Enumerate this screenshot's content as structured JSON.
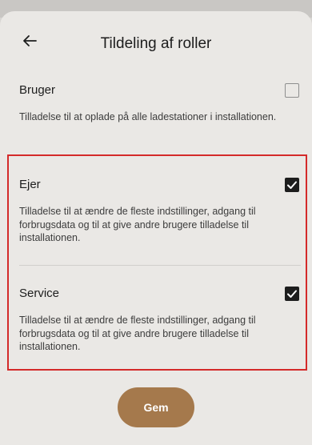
{
  "header": {
    "title": "Tildeling af roller"
  },
  "roles": [
    {
      "name": "Bruger",
      "checked": false,
      "description": "Tilladelse til at oplade på alle ladestationer i installationen."
    },
    {
      "name": "Ejer",
      "checked": true,
      "description": "Tilladelse til at ændre de fleste indstillinger, adgang til forbrugsdata og til at give andre brugere tilladelse til installationen."
    },
    {
      "name": "Service",
      "checked": true,
      "description": "Tilladelse til at ændre de fleste indstillinger, adgang til forbrugsdata og til at give andre brugere tilladelse til installationen."
    }
  ],
  "footer": {
    "save_label": "Gem"
  },
  "colors": {
    "accent": "#a5794c",
    "highlight": "#d42a2a",
    "checkbox_on": "#1d1d1d"
  }
}
